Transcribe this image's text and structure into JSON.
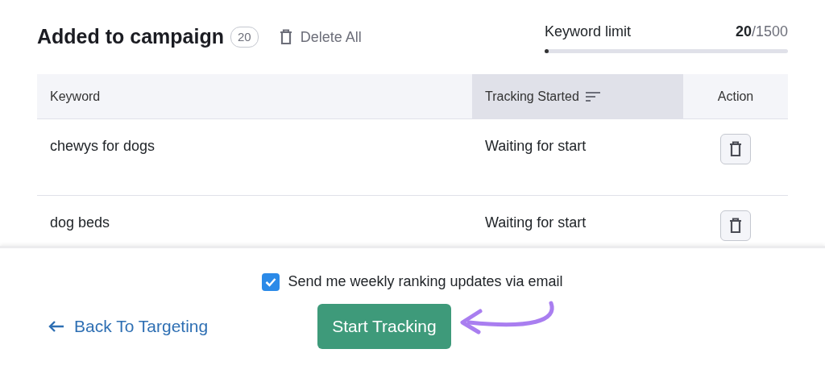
{
  "header": {
    "title": "Added to campaign",
    "count": "20",
    "delete_all": "Delete All"
  },
  "keyword_limit": {
    "label": "Keyword limit",
    "used": "20",
    "total": "/1500",
    "level": 0.013
  },
  "table": {
    "columns": [
      {
        "label": "Keyword",
        "sorted": false
      },
      {
        "label": "Tracking Started",
        "sorted": true
      },
      {
        "label": "Action",
        "sorted": false
      }
    ],
    "rows": [
      {
        "keyword": "chewys for dogs",
        "status": "Waiting for start"
      },
      {
        "keyword": "dog beds",
        "status": "Waiting for start"
      }
    ]
  },
  "footer": {
    "email_updates": {
      "label": "Send me weekly ranking updates via email",
      "checked": true
    },
    "back": "Back To Targeting",
    "start": "Start Tracking"
  }
}
